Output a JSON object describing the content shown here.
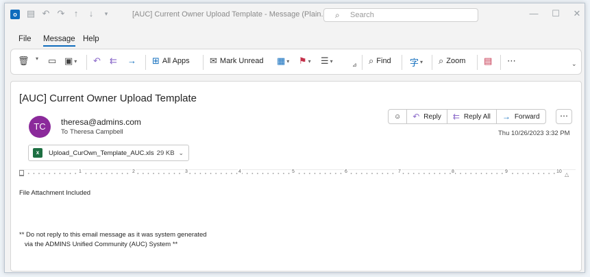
{
  "window": {
    "title": "[AUC] Current Owner Upload Template  -  Message (Plain...",
    "search_placeholder": "Search"
  },
  "menu": {
    "tabs": [
      {
        "label": "File"
      },
      {
        "label": "Message"
      },
      {
        "label": "Help"
      }
    ]
  },
  "ribbon": {
    "all_apps": "All Apps",
    "mark_unread": "Mark Unread",
    "find": "Find",
    "zoom": "Zoom"
  },
  "message": {
    "subject": "[AUC] Current Owner Upload Template",
    "avatar_initials": "TC",
    "sender": "theresa@admins.com",
    "to_label": "To",
    "to_name": "Theresa Campbell",
    "date": "Thu 10/26/2023 3:32 PM",
    "actions": {
      "reply": "Reply",
      "reply_all": "Reply All",
      "forward": "Forward"
    },
    "attachment": {
      "name": "Upload_CurOwn_Template_AUC.xls",
      "size": "29 KB"
    },
    "body": {
      "line1": "File Attachment Included",
      "line2": "** Do not reply to this email message as it was system generated",
      "line3": "   via the ADMINS Unified Community (AUC) System **"
    }
  },
  "ruler": {
    "numbers": [
      "1",
      "2",
      "3",
      "4",
      "5",
      "6",
      "7",
      "8",
      "9",
      "10"
    ]
  },
  "colors": {
    "accent": "#0f6cbd",
    "avatar": "#8b2a9b",
    "reply_icon": "#8a68c9"
  }
}
